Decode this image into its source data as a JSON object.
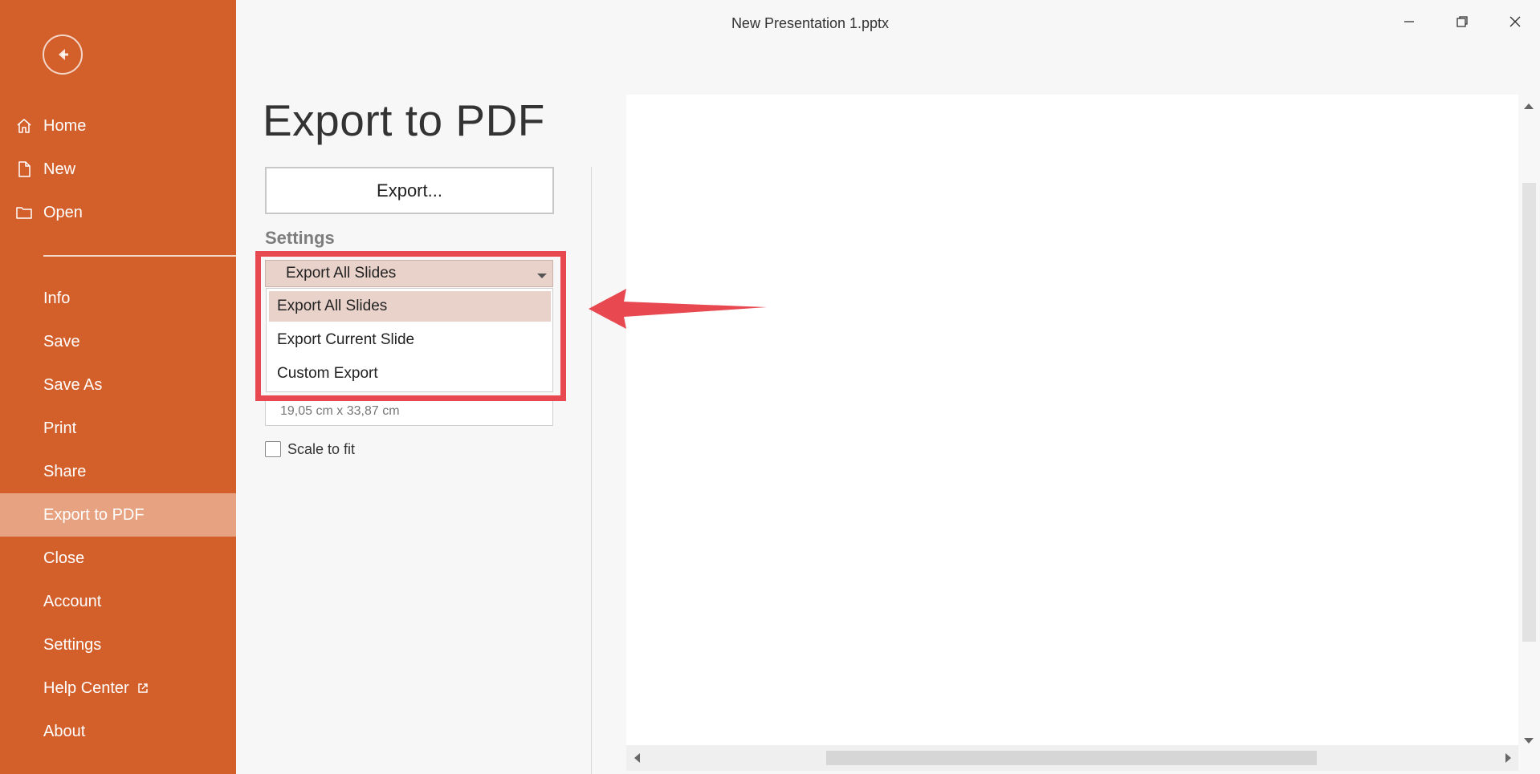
{
  "window": {
    "title": "New Presentation 1.pptx"
  },
  "sidebar": {
    "items": [
      {
        "label": "Home",
        "icon": "home-icon"
      },
      {
        "label": "New",
        "icon": "new-file-icon"
      },
      {
        "label": "Open",
        "icon": "folder-icon"
      },
      {
        "label": "Info"
      },
      {
        "label": "Save"
      },
      {
        "label": "Save As"
      },
      {
        "label": "Print"
      },
      {
        "label": "Share"
      },
      {
        "label": "Export to PDF",
        "active": true
      },
      {
        "label": "Close"
      },
      {
        "label": "Account"
      },
      {
        "label": "Settings"
      },
      {
        "label": "Help Center",
        "icon": "external-link-icon"
      },
      {
        "label": "About"
      }
    ]
  },
  "main": {
    "title": "Export to PDF",
    "export_button": "Export...",
    "settings_heading": "Settings",
    "range_dropdown": {
      "selected": "Export All Slides",
      "options": [
        "Export All Slides",
        "Export Current Slide",
        "Custom Export"
      ]
    },
    "slide_size": "19,05 cm x 33,87 cm",
    "scale_to_fit": {
      "label": "Scale to fit",
      "checked": false
    }
  },
  "colors": {
    "sidebar": "#d35f2b",
    "sidebar_active": "#e6a281",
    "dropdown_selected": "#e9d2ca",
    "annotation": "#e8484f"
  }
}
